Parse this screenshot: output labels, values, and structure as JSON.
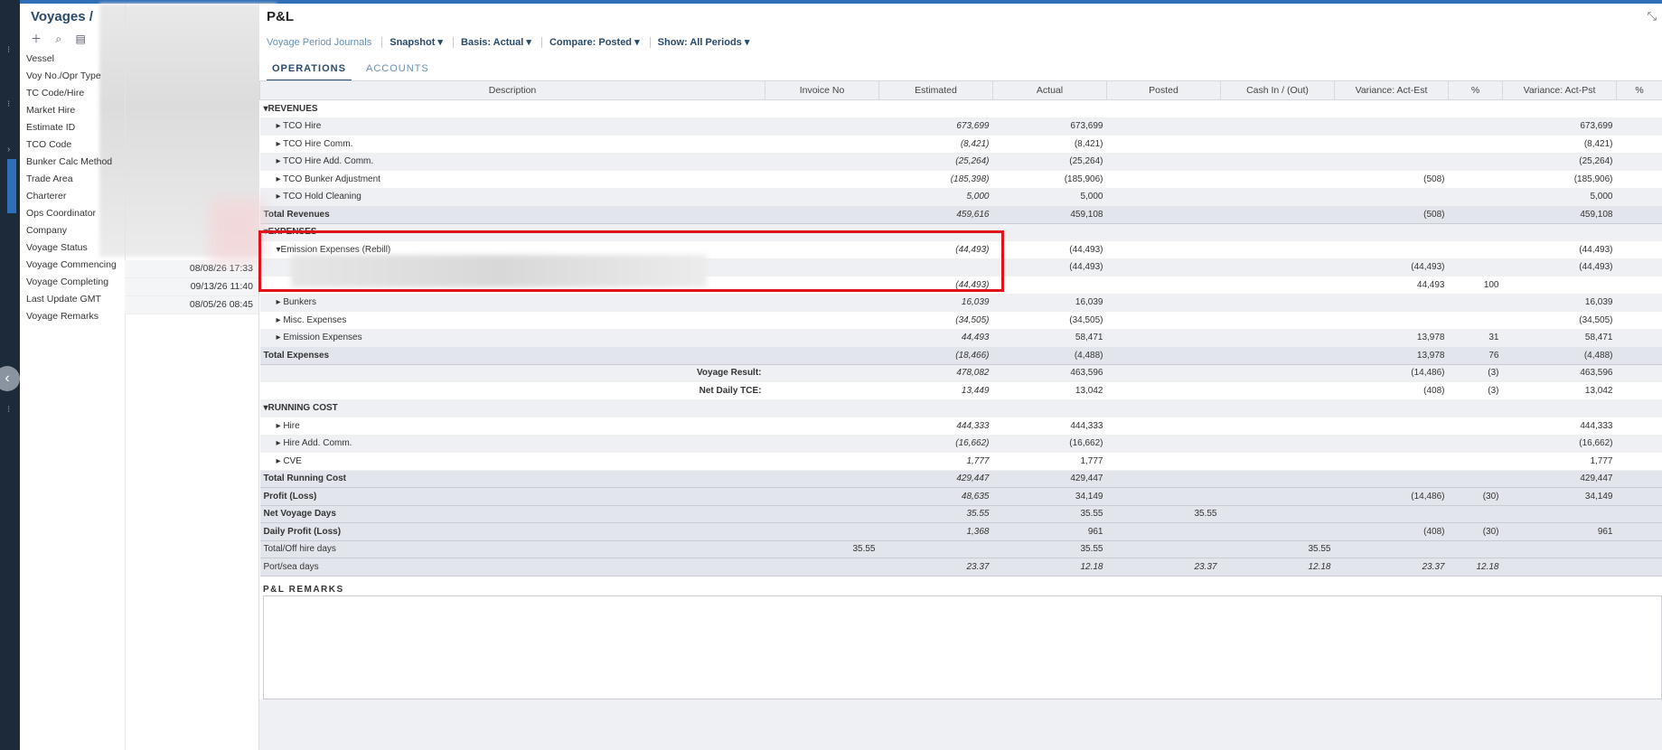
{
  "window": {
    "voyages_title": "Voyages /",
    "pl_title": "P&L"
  },
  "voyage_fields": [
    "Vessel",
    "Voy No./Opr Type",
    "TC Code/Hire",
    "Market Hire",
    "Estimate ID",
    "TCO Code",
    "Bunker Calc Method",
    "Trade Area",
    "Charterer",
    "Ops Coordinator",
    "Company",
    "Voyage Status",
    "Voyage Commencing",
    "Voyage Completing",
    "Last Update GMT",
    "Voyage Remarks"
  ],
  "voyage_values": [
    "08/08/26 17:33",
    "09/13/26 11:40",
    "08/05/26 08:45"
  ],
  "toolbar": {
    "link": "Voyage Period Journals",
    "snapshot": "Snapshot",
    "basis": "Basis: Actual",
    "compare": "Compare: Posted",
    "show": "Show: All Periods"
  },
  "tabs": [
    "OPERATIONS",
    "ACCOUNTS"
  ],
  "columns": [
    "Description",
    "Invoice No",
    "Estimated",
    "Actual",
    "Posted",
    "Cash In / (Out)",
    "Variance: Act-Est",
    "%",
    "Variance: Act-Pst",
    "%"
  ],
  "rows": [
    {
      "type": "section",
      "desc": "REVENUES",
      "cells": [
        "",
        "",
        "",
        "",
        "",
        "",
        "",
        "",
        ""
      ]
    },
    {
      "type": "child",
      "desc": "TCO Hire",
      "cells": [
        "",
        "673,699",
        "673,699",
        "",
        "",
        "",
        "",
        "673,699",
        ""
      ]
    },
    {
      "type": "child",
      "desc": "TCO Hire Comm.",
      "cells": [
        "",
        "(8,421)",
        "(8,421)",
        "",
        "",
        "",
        "",
        "(8,421)",
        ""
      ]
    },
    {
      "type": "child",
      "desc": "TCO Hire Add. Comm.",
      "cells": [
        "",
        "(25,264)",
        "(25,264)",
        "",
        "",
        "",
        "",
        "(25,264)",
        ""
      ]
    },
    {
      "type": "child",
      "desc": "TCO Bunker Adjustment",
      "cells": [
        "",
        "(185,398)",
        "(185,906)",
        "",
        "",
        "(508)",
        "",
        "(185,906)",
        ""
      ]
    },
    {
      "type": "child",
      "desc": "TCO Hold Cleaning",
      "cells": [
        "",
        "5,000",
        "5,000",
        "",
        "",
        "",
        "",
        "5,000",
        ""
      ]
    },
    {
      "type": "total",
      "desc": "Total Revenues",
      "cells": [
        "",
        "459,616",
        "459,108",
        "",
        "",
        "(508)",
        "",
        "459,108",
        ""
      ]
    },
    {
      "type": "section",
      "desc": "EXPENSES",
      "cells": [
        "",
        "",
        "",
        "",
        "",
        "",
        "",
        "",
        ""
      ]
    },
    {
      "type": "childopen",
      "desc": "Emission Expenses (Rebill)",
      "cells": [
        "",
        "(44,493)",
        "(44,493)",
        "",
        "",
        "",
        "",
        "(44,493)",
        ""
      ]
    },
    {
      "type": "sub",
      "desc": "",
      "cells": [
        "",
        "",
        "(44,493)",
        "",
        "",
        "(44,493)",
        "",
        "(44,493)",
        ""
      ]
    },
    {
      "type": "sub",
      "desc": "",
      "cells": [
        "",
        "(44,493)",
        "",
        "",
        "",
        "44,493",
        "100",
        "",
        ""
      ]
    },
    {
      "type": "child",
      "desc": "Bunkers",
      "cells": [
        "",
        "16,039",
        "16,039",
        "",
        "",
        "",
        "",
        "16,039",
        ""
      ]
    },
    {
      "type": "child",
      "desc": "Misc. Expenses",
      "cells": [
        "",
        "(34,505)",
        "(34,505)",
        "",
        "",
        "",
        "",
        "(34,505)",
        ""
      ]
    },
    {
      "type": "child",
      "desc": "Emission Expenses",
      "cells": [
        "",
        "44,493",
        "58,471",
        "",
        "",
        "13,978",
        "31",
        "58,471",
        ""
      ]
    },
    {
      "type": "total",
      "desc": "Total Expenses",
      "cells": [
        "",
        "(18,466)",
        "(4,488)",
        "",
        "",
        "13,978",
        "76",
        "(4,488)",
        ""
      ]
    },
    {
      "type": "result",
      "desc": "Voyage Result:",
      "cells": [
        "",
        "478,082",
        "463,596",
        "",
        "",
        "(14,486)",
        "(3)",
        "463,596",
        ""
      ]
    },
    {
      "type": "result",
      "desc": "Net Daily TCE:",
      "cells": [
        "",
        "13,449",
        "13,042",
        "",
        "",
        "(408)",
        "(3)",
        "13,042",
        ""
      ]
    },
    {
      "type": "section",
      "desc": "RUNNING COST",
      "cells": [
        "",
        "",
        "",
        "",
        "",
        "",
        "",
        "",
        ""
      ]
    },
    {
      "type": "child",
      "desc": "Hire",
      "cells": [
        "",
        "444,333",
        "444,333",
        "",
        "",
        "",
        "",
        "444,333",
        ""
      ]
    },
    {
      "type": "child",
      "desc": "Hire Add. Comm.",
      "cells": [
        "",
        "(16,662)",
        "(16,662)",
        "",
        "",
        "",
        "",
        "(16,662)",
        ""
      ]
    },
    {
      "type": "child",
      "desc": "CVE",
      "cells": [
        "",
        "1,777",
        "1,777",
        "",
        "",
        "",
        "",
        "1,777",
        ""
      ]
    },
    {
      "type": "total",
      "desc": "Total Running Cost",
      "cells": [
        "",
        "429,447",
        "429,447",
        "",
        "",
        "",
        "",
        "429,447",
        ""
      ]
    },
    {
      "type": "grand",
      "desc": "Profit (Loss)",
      "cells": [
        "",
        "48,635",
        "34,149",
        "",
        "",
        "(14,486)",
        "(30)",
        "34,149",
        ""
      ]
    },
    {
      "type": "grand",
      "desc": "Net Voyage Days",
      "cells": [
        "",
        "35.55",
        "35.55",
        "35.55",
        "",
        "",
        "",
        "",
        ""
      ]
    },
    {
      "type": "grand",
      "desc": "Daily Profit (Loss)",
      "cells": [
        "",
        "1,368",
        "961",
        "",
        "",
        "(408)",
        "(30)",
        "961",
        ""
      ]
    }
  ],
  "hire_days": {
    "label": "Total/Off hire days",
    "vals": [
      "35.55",
      "35.55",
      "35.55"
    ]
  },
  "port_sea": {
    "label": "Port/sea days",
    "vals": [
      "23.37",
      "12.18",
      "23.37",
      "12.18",
      "23.37",
      "12.18"
    ]
  },
  "remarks_label": "P&L REMARKS"
}
